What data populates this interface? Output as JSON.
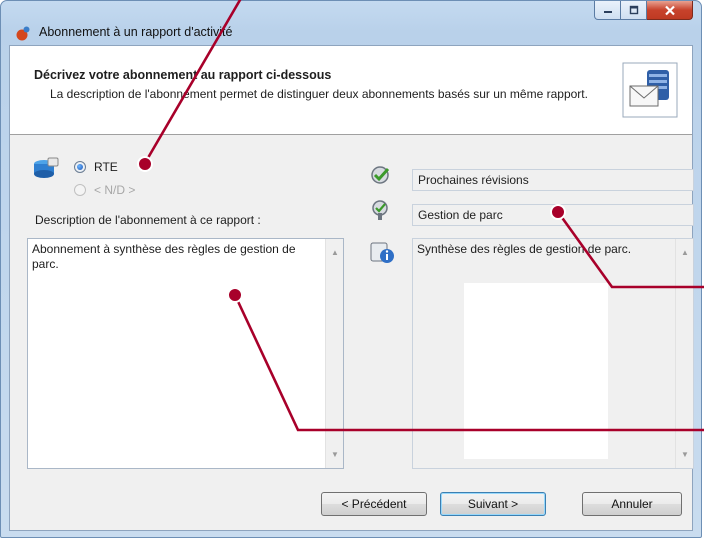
{
  "window": {
    "title": "Abonnement à un rapport d'activité"
  },
  "header": {
    "title": "Décrivez votre abonnement au rapport ci-dessous",
    "description": "La description de l'abonnement permet de distinguer deux abonnements basés sur un même rapport."
  },
  "radios": [
    {
      "label": "RTE",
      "selected": true,
      "enabled": true
    },
    {
      "label": "< N/D >",
      "selected": false,
      "enabled": false
    }
  ],
  "description_label": "Description de l'abonnement à ce rapport :",
  "description_value": "Abonnement à synthèse des règles de gestion de parc.",
  "details": {
    "revisions": "Prochaines révisions",
    "category": "Gestion de parc",
    "summary": "Synthèse des règles de gestion de parc."
  },
  "buttons": {
    "previous": "< Précédent",
    "next": "Suivant >",
    "cancel": "Annuler"
  },
  "colors": {
    "annotation": "#a8002a",
    "title_bar": "#b9d1ea",
    "close_button": "#c7422c"
  },
  "icons": [
    "app-icon",
    "subscription-header-icon",
    "database-icon",
    "revision-icon",
    "category-icon",
    "info-icon",
    "minimize-icon",
    "maximize-icon",
    "close-icon"
  ]
}
